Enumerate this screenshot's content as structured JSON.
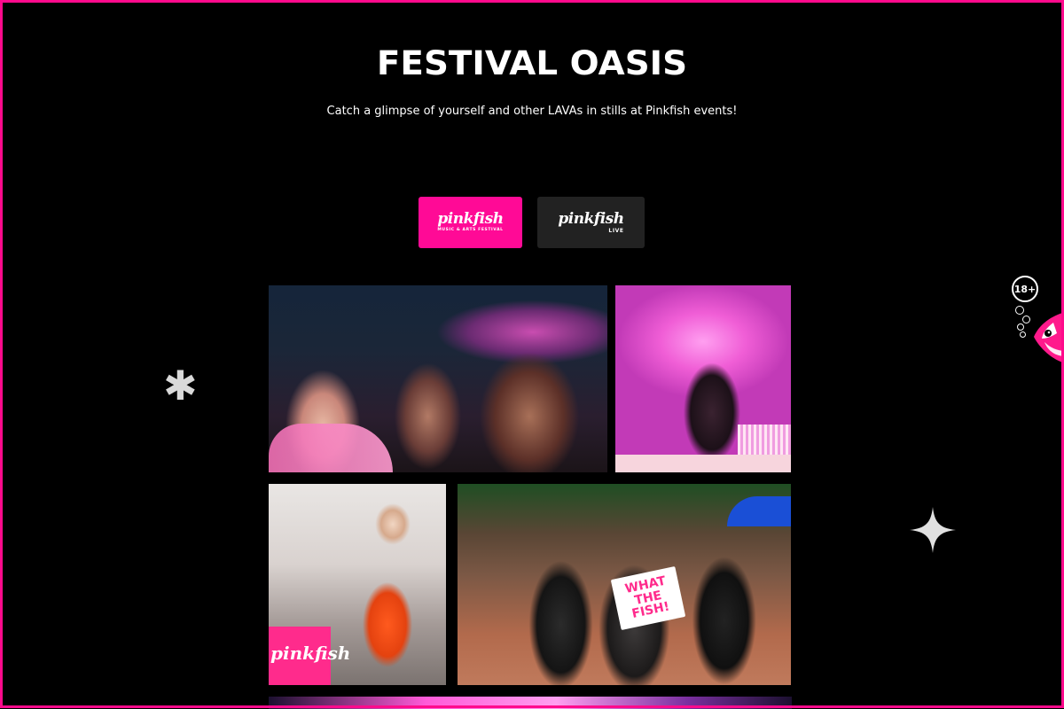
{
  "header": {
    "title": "FESTIVAL OASIS",
    "subtitle": "Catch a glimpse of yourself and other LAVAs in stills at Pinkfish events!"
  },
  "tabs": [
    {
      "logo_text": "pinkfish",
      "logo_sub": "MUSIC & ARTS FESTIVAL",
      "active": true
    },
    {
      "logo_text": "pinkfish",
      "logo_sub": "LIVE",
      "active": false
    }
  ],
  "gallery": {
    "photos": [
      {
        "name": "crowd-photo"
      },
      {
        "name": "dj-stage-photo"
      },
      {
        "name": "singer-performer-photo"
      },
      {
        "name": "group-fans-photo",
        "sign_text": "WHAT THE FISH!"
      },
      {
        "name": "stage-lights-photo"
      }
    ],
    "banner_text": "pinkfish"
  },
  "age_badge": {
    "label": "18+"
  },
  "colors": {
    "accent": "#ff0a8c",
    "background": "#000000",
    "inactive_tab": "#222222"
  },
  "icons": {
    "decor_left": "asterisk-icon",
    "decor_right": "sparkle-icon",
    "mascot": "fish-icon"
  }
}
